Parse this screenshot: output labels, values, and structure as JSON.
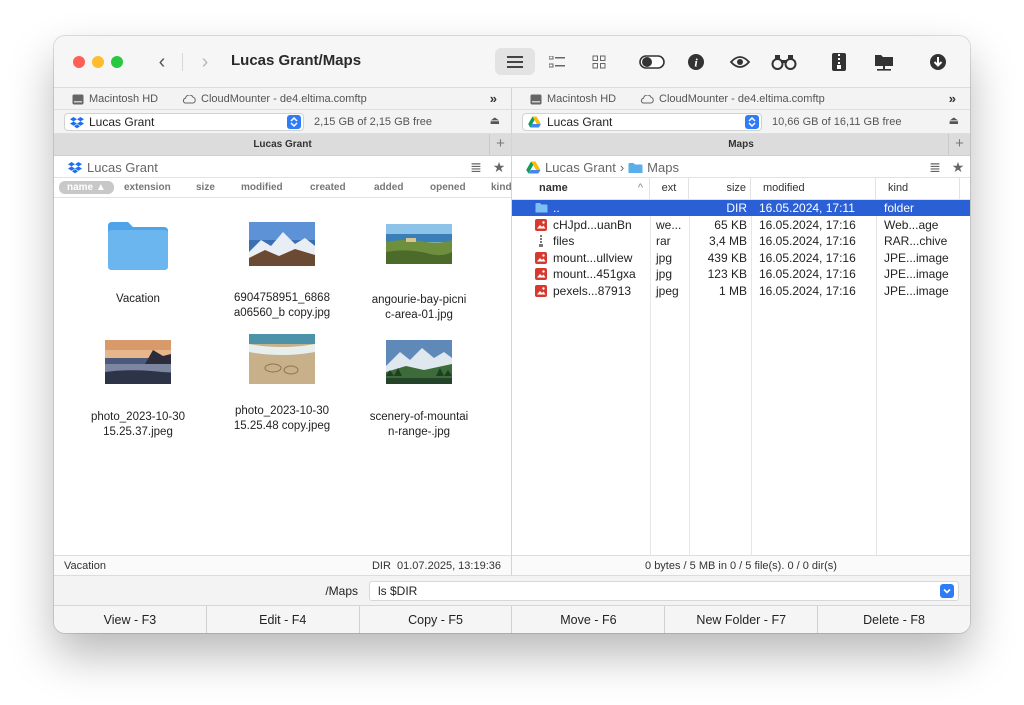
{
  "window": {
    "title": "Lucas Grant/Maps"
  },
  "drives": {
    "mac": "Macintosh HD",
    "cloud": "CloudMounter - de4.eltima.comftp",
    "more": "»"
  },
  "left": {
    "location": "Lucas Grant",
    "free": "2,15 GB of 2,15 GB free",
    "header": "Lucas Grant",
    "path": [
      "Lucas Grant"
    ],
    "columns": [
      "name ▲",
      "extension",
      "size",
      "modified",
      "created",
      "added",
      "opened",
      "kind"
    ],
    "items": [
      {
        "label": "Vacation",
        "kind": "folder-icon"
      },
      {
        "label": "6904758951_6868\na06560_b copy.jpg",
        "kind": "mountain-blue"
      },
      {
        "label": "angourie-bay-picni\nc-area-01.jpg",
        "kind": "coast-green"
      },
      {
        "label": "photo_2023-10-30\n15.25.37.jpeg",
        "kind": "sunset-beach"
      },
      {
        "label": "photo_2023-10-30\n15.25.48 copy.jpeg",
        "kind": "sand-beach"
      },
      {
        "label": "scenery-of-mountai\nn-range-.jpg",
        "kind": "mountain-valley"
      }
    ],
    "status_left": "Vacation",
    "status_right": "DIR  01.07.2025, 13:19:36"
  },
  "right": {
    "location": "Lucas Grant",
    "free": "10,66 GB of 16,11 GB free",
    "header": "Maps",
    "path": [
      "Lucas Grant",
      "›",
      "Maps"
    ],
    "columns": {
      "name": "name",
      "sort": "^",
      "ext": "ext",
      "size": "size",
      "modified": "modified",
      "kind": "kind"
    },
    "rows": [
      {
        "name": "..",
        "ext": "",
        "size": "DIR",
        "modified": "16.05.2024, 17:11",
        "kind": "folder",
        "icon": "folder"
      },
      {
        "name": "cHJpd...uanBn",
        "ext": "we...",
        "size": "65 KB",
        "modified": "16.05.2024, 17:16",
        "kind": "Web...age",
        "icon": "image"
      },
      {
        "name": "files",
        "ext": "rar",
        "size": "3,4 MB",
        "modified": "16.05.2024, 17:16",
        "kind": "RAR...chive",
        "icon": "archive"
      },
      {
        "name": "mount...ullview",
        "ext": "jpg",
        "size": "439 KB",
        "modified": "16.05.2024, 17:16",
        "kind": "JPE...image",
        "icon": "image"
      },
      {
        "name": "mount...451gxa",
        "ext": "jpg",
        "size": "123 KB",
        "modified": "16.05.2024, 17:16",
        "kind": "JPE...image",
        "icon": "image"
      },
      {
        "name": "pexels...87913",
        "ext": "jpeg",
        "size": "1 MB",
        "modified": "16.05.2024, 17:16",
        "kind": "JPE...image",
        "icon": "image"
      }
    ],
    "status": "0 bytes / 5 MB in 0 / 5 file(s). 0 / 0 dir(s)"
  },
  "command": {
    "path": "/Maps",
    "value": "ls $DIR"
  },
  "fkeys": [
    "View - F3",
    "Edit - F4",
    "Copy - F5",
    "Move - F6",
    "New Folder - F7",
    "Delete - F8"
  ],
  "colors": {
    "accent": "#2f7cf6",
    "selection": "#2a5fd6",
    "folder": "#6cb6ef"
  }
}
